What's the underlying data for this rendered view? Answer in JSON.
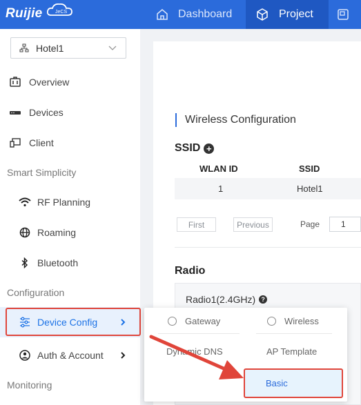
{
  "topbar": {
    "logo_text": "Ruijie",
    "logo_badge": "JeCS",
    "tabs": [
      {
        "label": "Dashboard",
        "icon": "home-icon"
      },
      {
        "label": "Project",
        "icon": "cube-icon"
      },
      {
        "label": "",
        "icon": "window-icon"
      }
    ],
    "active_tab": "Project"
  },
  "sidebar": {
    "project_selector": {
      "value": "Hotel1",
      "icon": "network-icon"
    },
    "items": [
      {
        "label": "Overview",
        "icon": "overview-icon"
      },
      {
        "label": "Devices",
        "icon": "devices-icon"
      },
      {
        "label": "Client",
        "icon": "client-icon"
      }
    ],
    "groups": {
      "smart": "Smart Simplicity",
      "config": "Configuration",
      "monitoring": "Monitoring"
    },
    "smart_items": [
      {
        "label": "RF Planning",
        "icon": "wifi-icon"
      },
      {
        "label": "Roaming",
        "icon": "globe-icon"
      },
      {
        "label": "Bluetooth",
        "icon": "bluetooth-icon"
      }
    ],
    "config_items": [
      {
        "label": "Device Config",
        "icon": "sliders-icon",
        "selected": true
      },
      {
        "label": "Auth & Account",
        "icon": "user-circle-icon"
      }
    ]
  },
  "main": {
    "section_title": "Wireless Configuration",
    "ssid_title": "SSID",
    "table": {
      "headers": [
        "WLAN ID",
        "SSID"
      ],
      "rows": [
        [
          "1",
          "Hotel1"
        ]
      ]
    },
    "pagination": {
      "first": "First",
      "previous": "Previous",
      "page_label": "Page",
      "page_value": "1"
    },
    "radio_title": "Radio",
    "radio1_label": "Radio1(2.4GHz)"
  },
  "dropdown": {
    "gateway": "Gateway",
    "wireless": "Wireless",
    "dynamic_dns": "Dynamic DNS",
    "ap_template": "AP Template",
    "basic": "Basic"
  },
  "colors": {
    "brand": "#2b6bdb",
    "highlight": "#e8f1fd",
    "annotation": "#e0453a"
  }
}
